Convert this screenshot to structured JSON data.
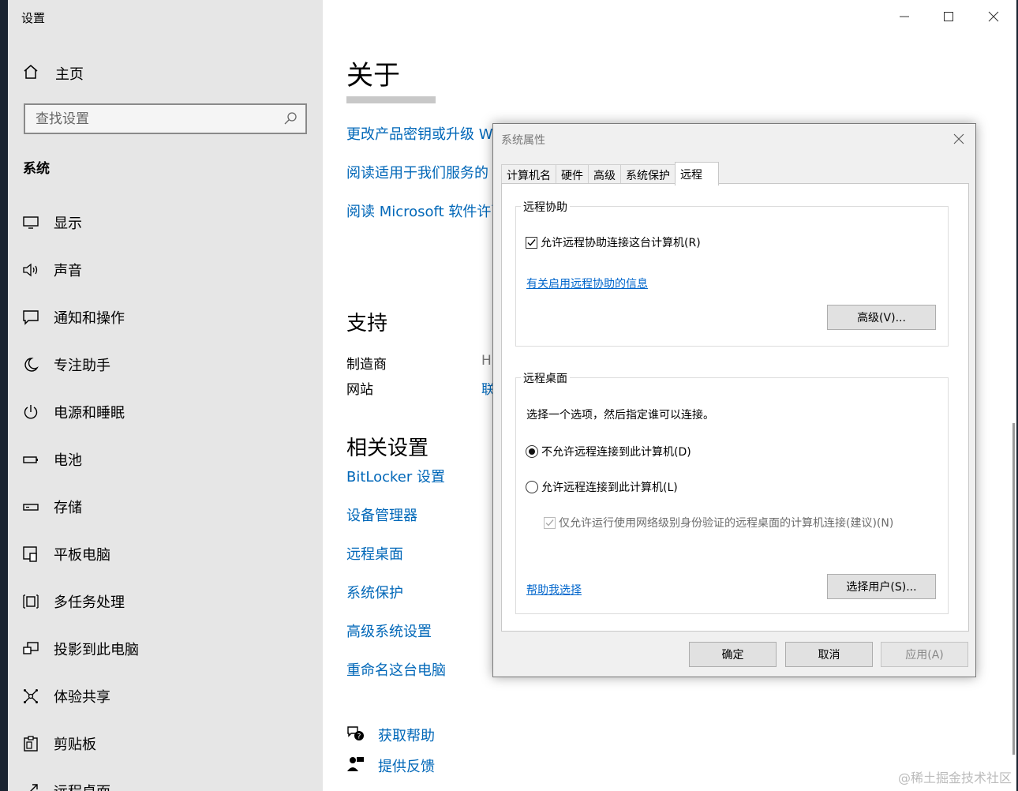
{
  "window": {
    "title": "设置"
  },
  "sidebar": {
    "home_label": "主页",
    "search_placeholder": "查找设置",
    "section_title": "系统",
    "items": [
      {
        "label": "显示",
        "icon": "monitor-icon"
      },
      {
        "label": "声音",
        "icon": "speaker-icon"
      },
      {
        "label": "通知和操作",
        "icon": "notification-icon"
      },
      {
        "label": "专注助手",
        "icon": "moon-icon"
      },
      {
        "label": "电源和睡眠",
        "icon": "power-icon"
      },
      {
        "label": "电池",
        "icon": "battery-icon"
      },
      {
        "label": "存储",
        "icon": "storage-icon"
      },
      {
        "label": "平板电脑",
        "icon": "tablet-icon"
      },
      {
        "label": "多任务处理",
        "icon": "multitask-icon"
      },
      {
        "label": "投影到此电脑",
        "icon": "project-icon"
      },
      {
        "label": "体验共享",
        "icon": "share-icon"
      },
      {
        "label": "剪贴板",
        "icon": "clipboard-icon"
      },
      {
        "label": "远程桌面",
        "icon": "remote-icon"
      }
    ]
  },
  "main": {
    "title": "关于",
    "links": [
      "更改产品密钥或升级 Wi",
      "阅读适用于我们服务的 M",
      "阅读 Microsoft 软件许可"
    ],
    "support": {
      "title": "支持",
      "manufacturer_label": "制造商",
      "manufacturer_value": "H",
      "website_label": "网站",
      "website_value": "联"
    },
    "related": {
      "title": "相关设置",
      "links": [
        "BitLocker 设置",
        "设备管理器",
        "远程桌面",
        "系统保护",
        "高级系统设置",
        "重命名这台电脑"
      ]
    },
    "help": {
      "get_help": "获取帮助",
      "feedback": "提供反馈"
    }
  },
  "dialog": {
    "title": "系统属性",
    "tabs": [
      "计算机名",
      "硬件",
      "高级",
      "系统保护",
      "远程"
    ],
    "active_tab": "远程",
    "assistance": {
      "group_label": "远程协助",
      "checkbox_label": "允许远程协助连接这台计算机(R)",
      "checked": true,
      "info_link": "有关启用远程协助的信息",
      "advanced_button": "高级(V)..."
    },
    "desktop": {
      "group_label": "远程桌面",
      "instruction": "选择一个选项，然后指定谁可以连接。",
      "option_deny": "不允许远程连接到此计算机(D)",
      "option_allow": "允许远程连接到此计算机(L)",
      "selected": "deny",
      "nla_label": "仅允许运行使用网络级别身份验证的远程桌面的计算机连接(建议)(N)",
      "help_link": "帮助我选择",
      "select_users_button": "选择用户(S)..."
    },
    "buttons": {
      "ok": "确定",
      "cancel": "取消",
      "apply": "应用(A)"
    }
  },
  "watermark": "@稀土掘金技术社区"
}
